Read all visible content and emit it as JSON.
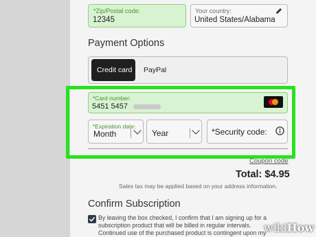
{
  "address": {
    "zip_label": "*Zip/Postal code:",
    "zip_value": "12345",
    "country_label": "Your country:",
    "country_value": "United States/Alabama"
  },
  "payment": {
    "heading": "Payment Options",
    "tabs": [
      {
        "label": "Credit card",
        "selected": true
      },
      {
        "label": "PayPal",
        "selected": false
      }
    ],
    "card_number_label": "*Card number:",
    "card_number_visible": "5451 5457",
    "card_brand_icon": "mastercard-icon",
    "expiration_label": "*Expiration date:",
    "month_value": "Month",
    "year_value": "Year",
    "security_placeholder": "*Security code:",
    "coupon_link": "Coupon code"
  },
  "summary": {
    "total": "Total: $4.95",
    "tax_note": "Sales tax may be applied based on your address information."
  },
  "confirm": {
    "heading": "Confirm Subscription",
    "checkbox_checked": true,
    "text_lines": [
      "By leaving the box checked, I confirm that I am signing up for a",
      "subscription product that will be billed in regular intervals.",
      "Continued use of the purchased product is contingent upon my"
    ]
  },
  "watermark": {
    "prefix": "wiki",
    "suffix": "How"
  },
  "colors": {
    "highlight": "#27e31e",
    "selected_tab": "#1f1f1f",
    "field_green": "#d8f3d1",
    "checkbox_accent": "#2f3a4a"
  }
}
